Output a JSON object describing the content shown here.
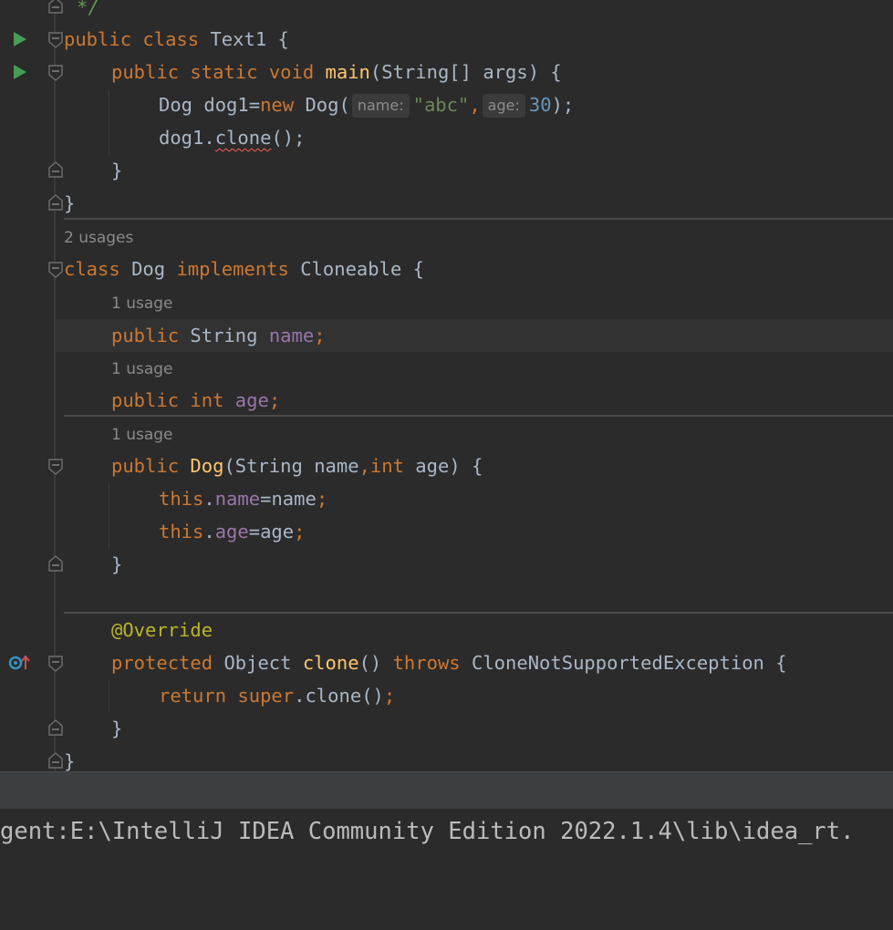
{
  "editor": {
    "comment_close": "*/",
    "kw": {
      "public": "public",
      "class": "class",
      "static": "static",
      "void": "void",
      "new": "new",
      "implements": "implements",
      "int": "int",
      "this": "this",
      "protected": "protected",
      "throws": "throws",
      "return": "return",
      "super": "super"
    },
    "names": {
      "text1": "Text1",
      "main": "main",
      "string_arr": "String[]",
      "args": "args",
      "dog": "Dog",
      "dog1": "dog1",
      "clone": "clone",
      "cloneable": "Cloneable",
      "string": "String",
      "name": "name",
      "age": "age",
      "override": "@Override",
      "object": "Object",
      "exception": "CloneNotSupportedException"
    },
    "literals": {
      "abc": "\"abc\"",
      "thirty": "30"
    },
    "hints": {
      "name": "name:",
      "age": "age:"
    },
    "usages": {
      "two": "2 usages",
      "one": "1 usage"
    },
    "punct": {
      "lbrace": "{",
      "rbrace": "}",
      "paren_open": "(",
      "main_params_close": ") {",
      "eq": "=",
      "comma": ",",
      "close_stmt": ");",
      "dot": ".",
      "call_empty": "();",
      "semi": ";",
      "space_comma": ",",
      "ctor_close": ") {",
      "empty_parens": "()",
      "space": " "
    }
  },
  "console": {
    "output": "gent:E:\\IntelliJ IDEA Community Edition 2022.1.4\\lib\\idea_rt."
  },
  "colors": {
    "background": "#2b2b2b",
    "keyword": "#cc7832",
    "function": "#ffc66d",
    "field": "#9876aa",
    "string": "#6a8759",
    "number": "#6897bb",
    "annotation": "#bbb529",
    "text": "#a9b7c6",
    "run_icon": "#499c54"
  },
  "icons": {
    "run_class": "run-triangle-icon",
    "run_main": "run-triangle-icon",
    "override": "overrides-method-icon",
    "fold": "fold-marker-icon"
  }
}
